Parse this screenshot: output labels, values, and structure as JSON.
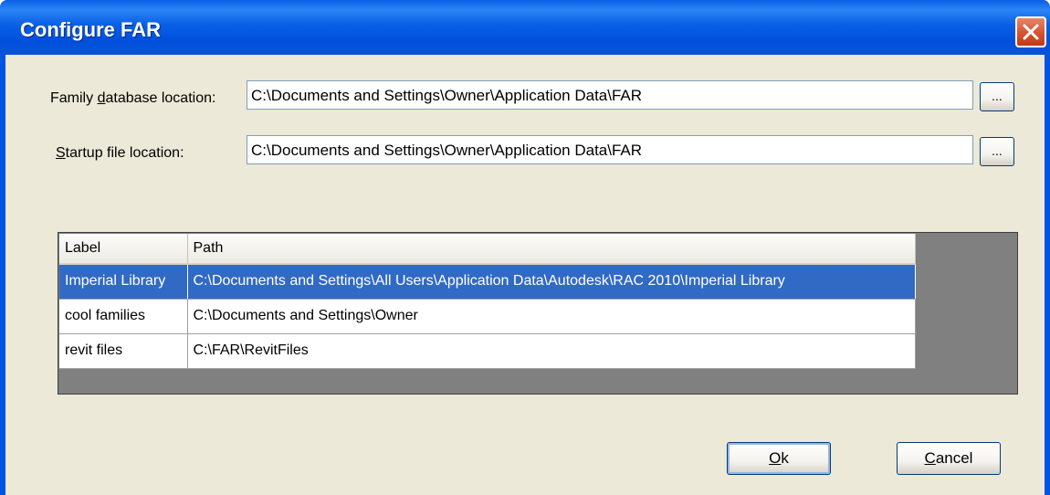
{
  "window": {
    "title": "Configure FAR"
  },
  "fields": {
    "family_db": {
      "label_prefix": "Family ",
      "label_accel": "d",
      "label_suffix": "atabase location:",
      "value": "C:\\Documents and Settings\\Owner\\Application Data\\FAR",
      "browse_label": "..."
    },
    "startup": {
      "label_prefix": "",
      "label_accel": "S",
      "label_suffix": "tartup file location:",
      "value": "C:\\Documents and Settings\\Owner\\Application Data\\FAR",
      "browse_label": "..."
    }
  },
  "grid": {
    "columns": [
      "Label",
      "Path"
    ],
    "rows": [
      {
        "label": "Imperial Library",
        "path": "C:\\Documents and Settings\\All Users\\Application Data\\Autodesk\\RAC 2010\\Imperial Library",
        "selected": true
      },
      {
        "label": "cool families",
        "path": "C:\\Documents and Settings\\Owner",
        "selected": false
      },
      {
        "label": "revit files",
        "path": "C:\\FAR\\RevitFiles",
        "selected": false
      }
    ]
  },
  "buttons": {
    "ok": {
      "accel": "O",
      "rest": "k"
    },
    "cancel": {
      "accel": "C",
      "rest": "ancel"
    }
  },
  "colors": {
    "titlebar": "#0054e3",
    "selection": "#316ac5",
    "close_button": "#d4532f",
    "dialog_background": "#ece9d8"
  },
  "icons": {
    "close": "close-x-icon"
  }
}
